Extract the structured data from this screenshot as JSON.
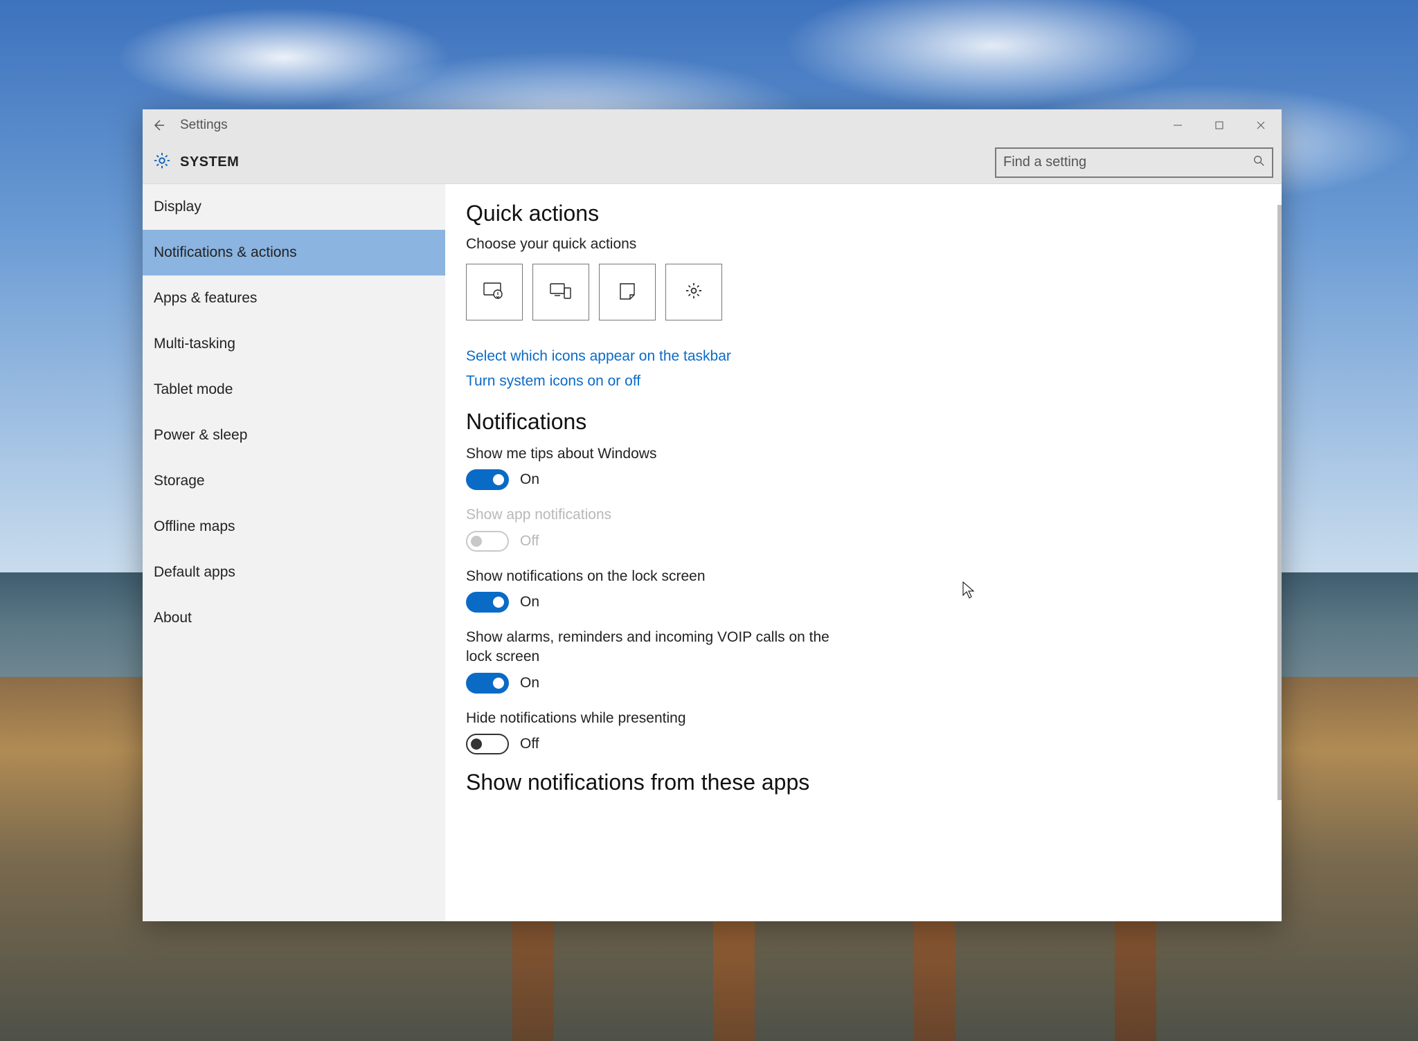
{
  "window": {
    "title": "Settings",
    "system_label": "SYSTEM"
  },
  "search": {
    "placeholder": "Find a setting"
  },
  "sidebar": {
    "items": [
      {
        "label": "Display"
      },
      {
        "label": "Notifications & actions"
      },
      {
        "label": "Apps & features"
      },
      {
        "label": "Multi-tasking"
      },
      {
        "label": "Tablet mode"
      },
      {
        "label": "Power & sleep"
      },
      {
        "label": "Storage"
      },
      {
        "label": "Offline maps"
      },
      {
        "label": "Default apps"
      },
      {
        "label": "About"
      }
    ],
    "active_index": 1
  },
  "content": {
    "quick_actions": {
      "heading": "Quick actions",
      "subtext": "Choose your quick actions",
      "tiles": [
        {
          "icon": "tablet-tap-icon"
        },
        {
          "icon": "connect-devices-icon"
        },
        {
          "icon": "note-icon"
        },
        {
          "icon": "gear-icon"
        }
      ],
      "links": [
        "Select which icons appear on the taskbar",
        "Turn system icons on or off"
      ]
    },
    "notifications": {
      "heading": "Notifications",
      "toggles": [
        {
          "label": "Show me tips about Windows",
          "state": "On",
          "on": true,
          "disabled": false
        },
        {
          "label": "Show app notifications",
          "state": "Off",
          "on": false,
          "disabled": true
        },
        {
          "label": "Show notifications on the lock screen",
          "state": "On",
          "on": true,
          "disabled": false
        },
        {
          "label": "Show alarms, reminders and incoming VOIP calls on the lock screen",
          "state": "On",
          "on": true,
          "disabled": false
        },
        {
          "label": "Hide notifications while presenting",
          "state": "Off",
          "on": false,
          "disabled": false
        }
      ]
    },
    "apps_heading": "Show notifications from these apps"
  }
}
